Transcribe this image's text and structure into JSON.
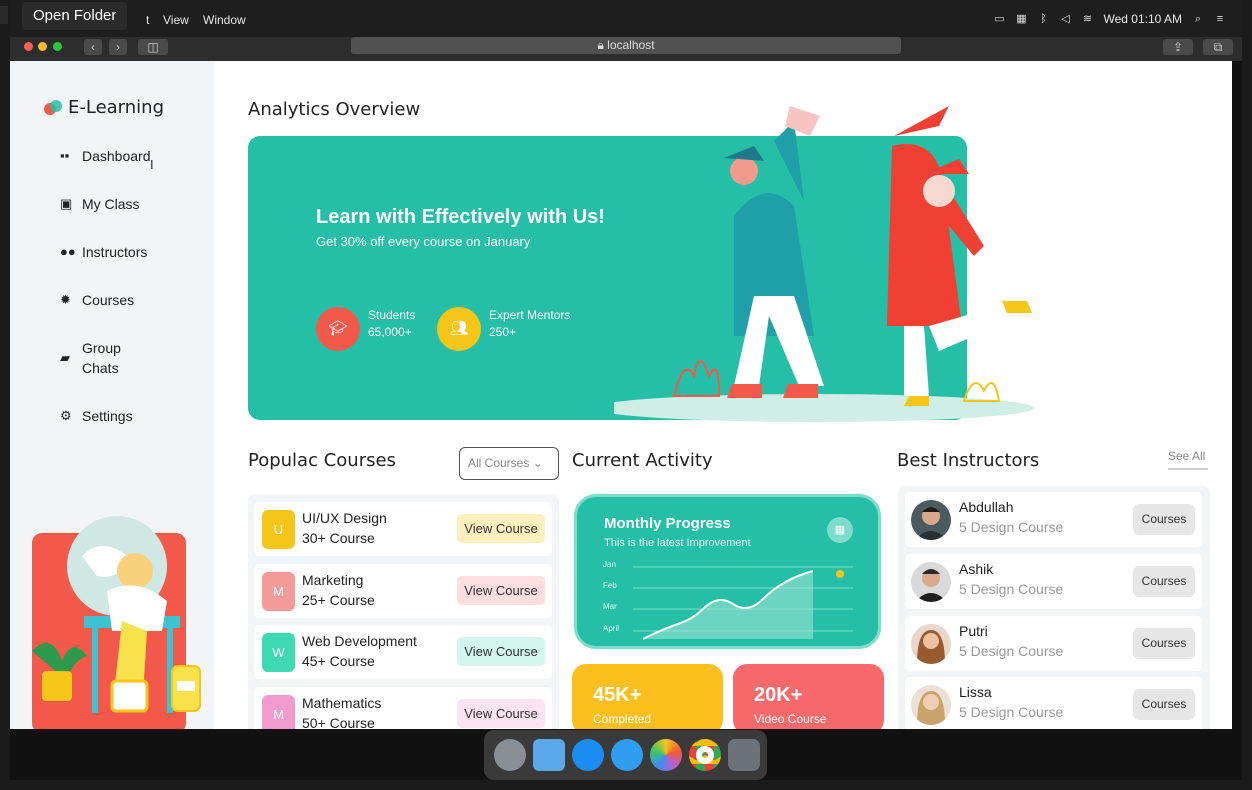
{
  "menubar": {
    "tooltip": "Open Folder",
    "menus": [
      "t",
      "View",
      "Window"
    ],
    "clock": "Wed 01:10 AM"
  },
  "browser": {
    "url": "localhost"
  },
  "sidebar": {
    "brand": "E-Learning",
    "items": [
      {
        "label": "Dashboard",
        "icon": "grid-icon"
      },
      {
        "label": "My Class",
        "icon": "book-icon"
      },
      {
        "label": "Instructors",
        "icon": "people-icon"
      },
      {
        "label": "Courses",
        "icon": "bulb-icon"
      },
      {
        "label": "Group\nChats",
        "icon": "chat-icon"
      },
      {
        "label": "Settings",
        "icon": "gear-icon"
      }
    ]
  },
  "analytics": {
    "title": "Analytics Overview",
    "hero_title": "Learn with Effectively with Us!",
    "hero_subtitle": "Get 30% off every course on January",
    "stats": [
      {
        "label": "Students",
        "value": "65,000+",
        "color": "#f2594b"
      },
      {
        "label": "Expert Mentors",
        "value": "250+",
        "color": "#f5c518"
      }
    ]
  },
  "courses": {
    "title": "Populac Courses",
    "filter": "All Courses",
    "items": [
      {
        "letter": "U",
        "name": "UI/UX Design",
        "count": "30+ Course",
        "button": "View Course",
        "color": "#f5c518",
        "btn_bg": "#fdf0bf"
      },
      {
        "letter": "M",
        "name": "Marketing",
        "count": "25+ Course",
        "button": "View Course",
        "color": "#f49a98",
        "btn_bg": "#fddede"
      },
      {
        "letter": "W",
        "name": "Web Development",
        "count": "45+ Course",
        "button": "View Course",
        "color": "#3dd9b3",
        "btn_bg": "#d3f6ec"
      },
      {
        "letter": "M",
        "name": "Mathematics",
        "count": "50+ Course",
        "button": "View Course",
        "color": "#f19ad0",
        "btn_bg": "#fde3f2"
      }
    ]
  },
  "activity": {
    "title": "Current Activity",
    "card_title": "Monthly Progress",
    "card_subtitle": "This is the latest Improvement",
    "months": [
      "Jan",
      "Feb",
      "Mar",
      "April"
    ],
    "tiles": [
      {
        "number": "45K+",
        "label": "Completed",
        "color": "#fcbf1e"
      },
      {
        "number": "20K+",
        "label": "Video Course",
        "color": "#f7696b"
      }
    ]
  },
  "instructors": {
    "title": "Best Instructors",
    "see_all": "See All",
    "items": [
      {
        "name": "Abdullah",
        "sub": "5 Design Course",
        "button": "Courses"
      },
      {
        "name": "Ashik",
        "sub": "5 Design Course",
        "button": "Courses"
      },
      {
        "name": "Putri",
        "sub": "5 Design Course",
        "button": "Courses"
      },
      {
        "name": "Lissa",
        "sub": "5 Design Course",
        "button": "Courses"
      }
    ]
  }
}
